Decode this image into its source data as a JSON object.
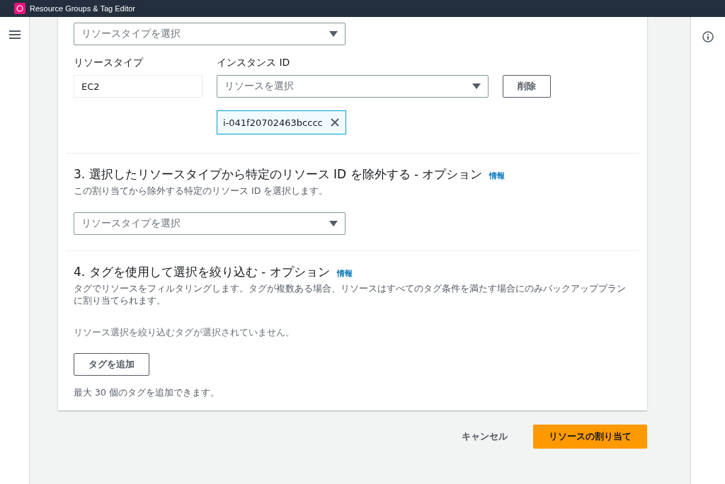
{
  "top_bar": {
    "title": "Resource Groups & Tag Editor"
  },
  "section_2": {
    "type_select": {
      "placeholder": "リソースタイプを選択"
    },
    "row": {
      "type_label": "リソースタイプ",
      "type_value": "EC2",
      "id_label": "インスタンス ID",
      "id_select": {
        "placeholder": "リソースを選択"
      },
      "remove_button": "削除",
      "tokens": [
        "i-041f20702463bcccc"
      ]
    }
  },
  "section_3": {
    "heading": "3. 選択したリソースタイプから特定のリソース ID を除外する - オプション",
    "info_link": "情報",
    "description": "この割り当てから除外する特定のリソース ID を選択します。",
    "type_select": {
      "placeholder": "リソースタイプを選択"
    }
  },
  "section_4": {
    "heading": "4. タグを使用して選択を絞り込む - オプション",
    "info_link": "情報",
    "description": "タグでリソースをフィルタリングします。タグが複数ある場合、リソースはすべてのタグ条件を満たす場合にのみバックアッププランに割り当てられます。",
    "empty_text": "リソース選択を絞り込むタグが選択されていません。",
    "add_button": "タグを追加",
    "hint": "最大 30 個のタグを追加できます。"
  },
  "footer": {
    "cancel": "キャンセル",
    "submit": "リソースの割り当て"
  }
}
